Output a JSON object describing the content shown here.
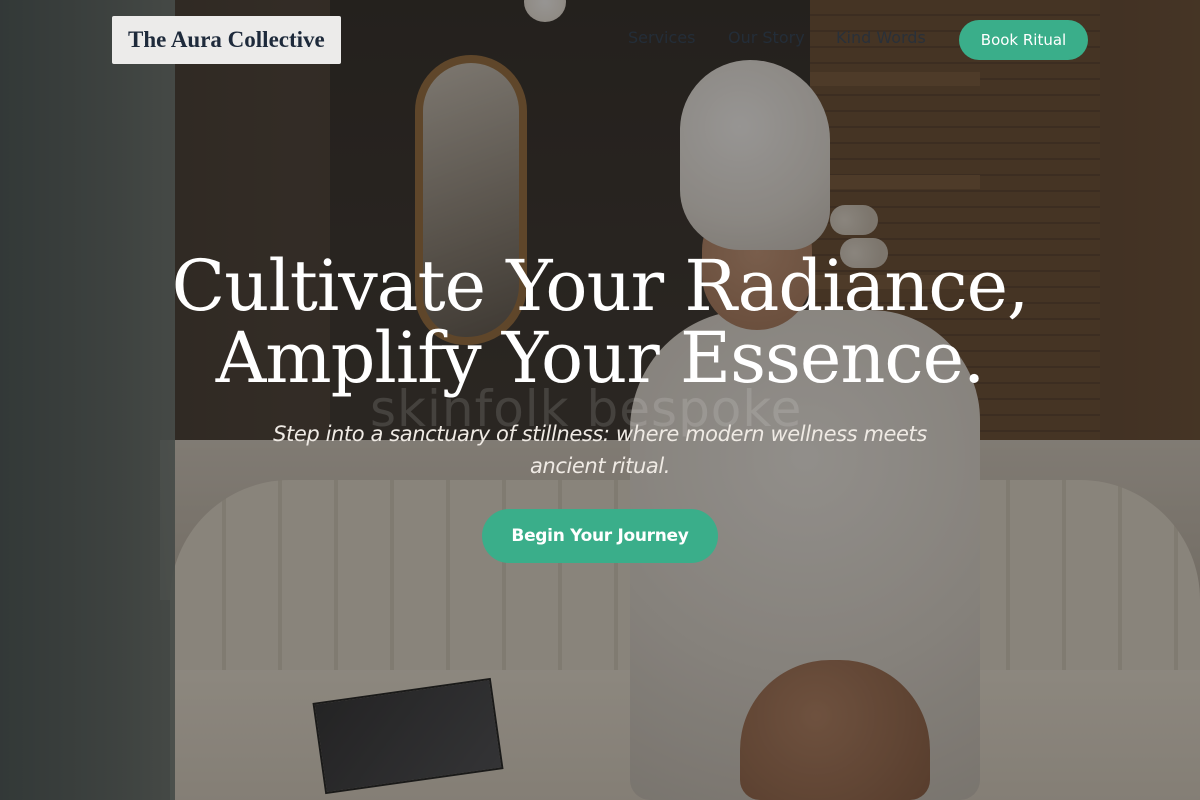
{
  "brand": {
    "name": "The Aura Collective"
  },
  "nav": {
    "items": [
      {
        "label": "Services"
      },
      {
        "label": "Our Story"
      },
      {
        "label": "Kind Words"
      }
    ],
    "book_label": "Book Ritual"
  },
  "hero": {
    "title_line1": "Cultivate Your Radiance,",
    "title_line2": "Amplify Your Essence.",
    "subtitle": "Step into a sanctuary of stillness: where modern wellness meets ancient ritual.",
    "cta_label": "Begin Your Journey",
    "watermark": "skinfolk bespoke"
  },
  "colors": {
    "accent": "#3aae8a",
    "brand_text": "#1e2a3b",
    "brand_bg": "#ecebea",
    "hero_text": "#ffffff"
  }
}
